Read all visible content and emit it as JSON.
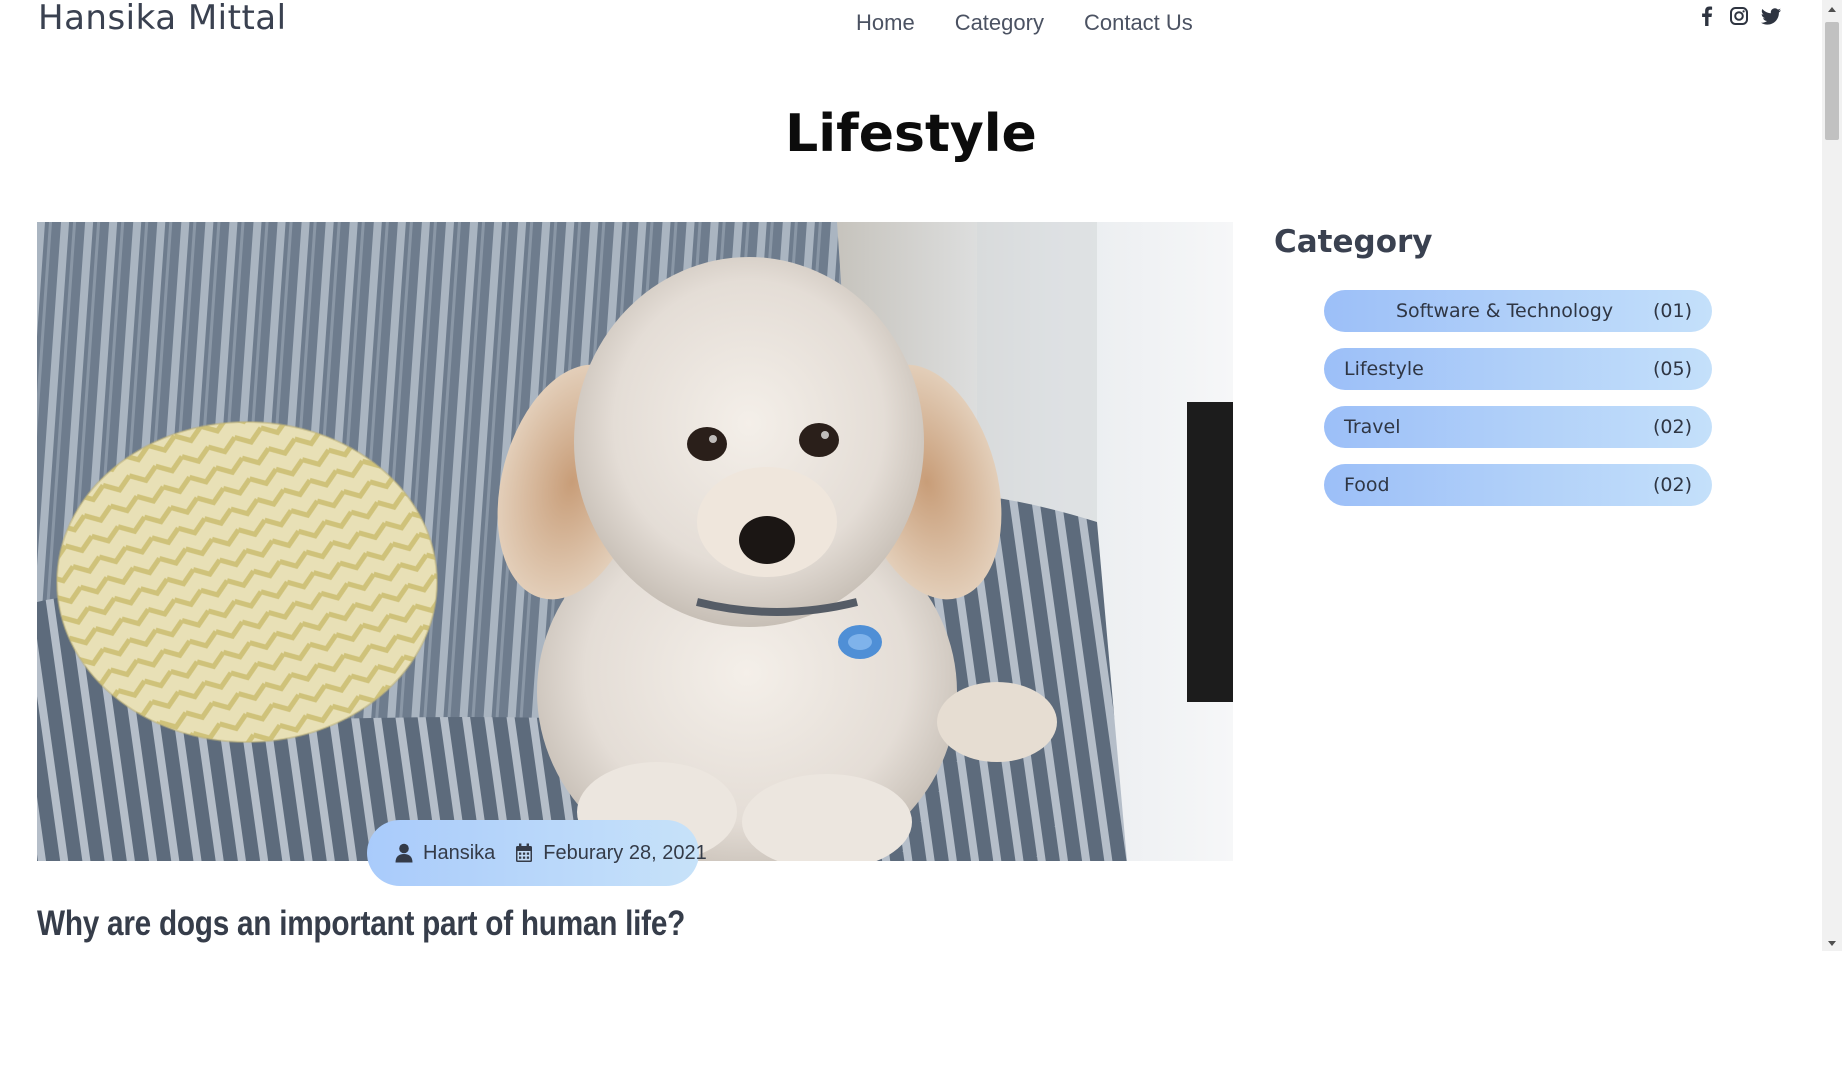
{
  "header": {
    "brand": "Hansika Mittal",
    "nav": [
      "Home",
      "Category",
      "Contact Us"
    ],
    "social": [
      "facebook-icon",
      "instagram-icon",
      "twitter-icon"
    ]
  },
  "page_title": "Lifestyle",
  "post": {
    "author": "Hansika",
    "date": "Feburary 28, 2021",
    "title": "Why are dogs an important part of human life?",
    "image_subject": "white fluffy dog on striped armchair"
  },
  "sidebar": {
    "title": "Category",
    "categories": [
      {
        "label": "Software & Technology",
        "count": "(01)"
      },
      {
        "label": "Lifestyle",
        "count": "(05)"
      },
      {
        "label": "Travel",
        "count": "(02)"
      },
      {
        "label": "Food",
        "count": "(02)"
      }
    ]
  },
  "colors": {
    "pill_start": "#9cbff8",
    "pill_end": "#c4e0fa",
    "text_dark": "#3a4150"
  }
}
